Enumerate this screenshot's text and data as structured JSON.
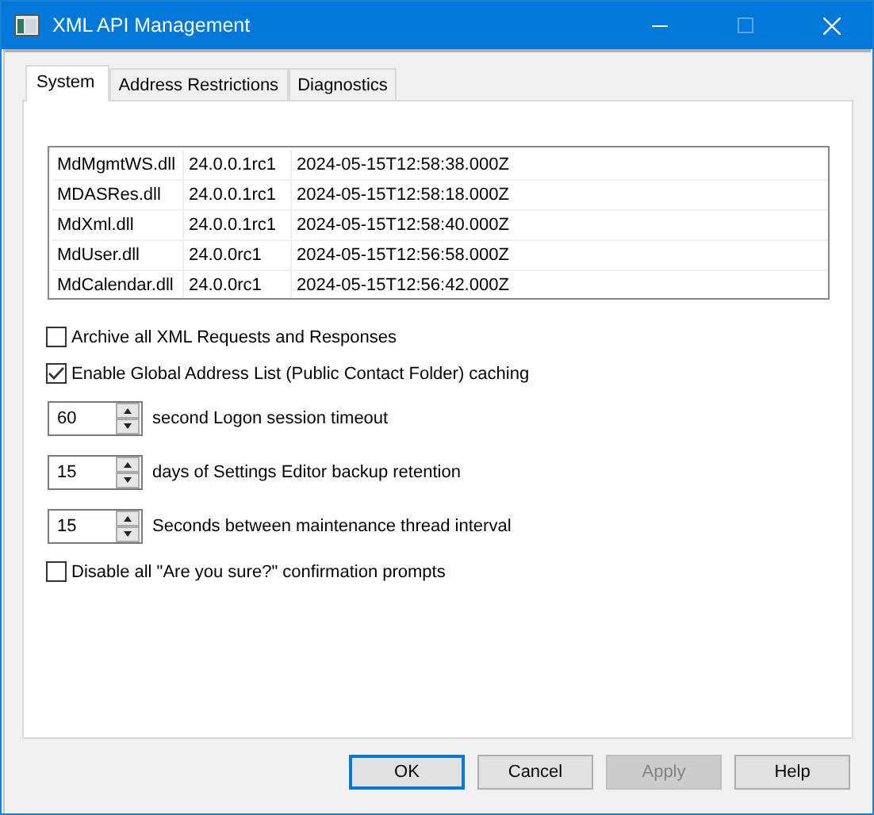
{
  "window": {
    "title": "XML API Management"
  },
  "tabs": [
    {
      "label": "System",
      "selected": true
    },
    {
      "label": "Address Restrictions",
      "selected": false
    },
    {
      "label": "Diagnostics",
      "selected": false
    }
  ],
  "modules": [
    {
      "name": "MdMgmtWS.dll",
      "version": "24.0.0.1rc1",
      "timestamp": "2024-05-15T12:58:38.000Z"
    },
    {
      "name": "MDASRes.dll",
      "version": "24.0.0.1rc1",
      "timestamp": "2024-05-15T12:58:18.000Z"
    },
    {
      "name": "MdXml.dll",
      "version": "24.0.0.1rc1",
      "timestamp": "2024-05-15T12:58:40.000Z"
    },
    {
      "name": "MdUser.dll",
      "version": "24.0.0rc1",
      "timestamp": "2024-05-15T12:56:58.000Z"
    },
    {
      "name": "MdCalendar.dll",
      "version": "24.0.0rc1",
      "timestamp": "2024-05-15T12:56:42.000Z"
    }
  ],
  "options": [
    {
      "label": "Archive all XML Requests and Responses",
      "checked": false
    },
    {
      "label": "Enable Global Address List (Public Contact Folder) caching",
      "checked": true
    }
  ],
  "spinners": [
    {
      "value": "60",
      "label": "second Logon session timeout"
    },
    {
      "value": "15",
      "label": "days of Settings Editor backup retention"
    },
    {
      "value": "15",
      "label": "Seconds between maintenance thread interval"
    }
  ],
  "more_options": [
    {
      "label": "Disable all \"Are you sure?\" confirmation prompts",
      "checked": false
    }
  ],
  "buttons": [
    {
      "label": "OK",
      "default": true,
      "disabled": false
    },
    {
      "label": "Cancel",
      "default": false,
      "disabled": false
    },
    {
      "label": "Apply",
      "default": false,
      "disabled": true
    },
    {
      "label": "Help",
      "default": false,
      "disabled": false
    }
  ]
}
